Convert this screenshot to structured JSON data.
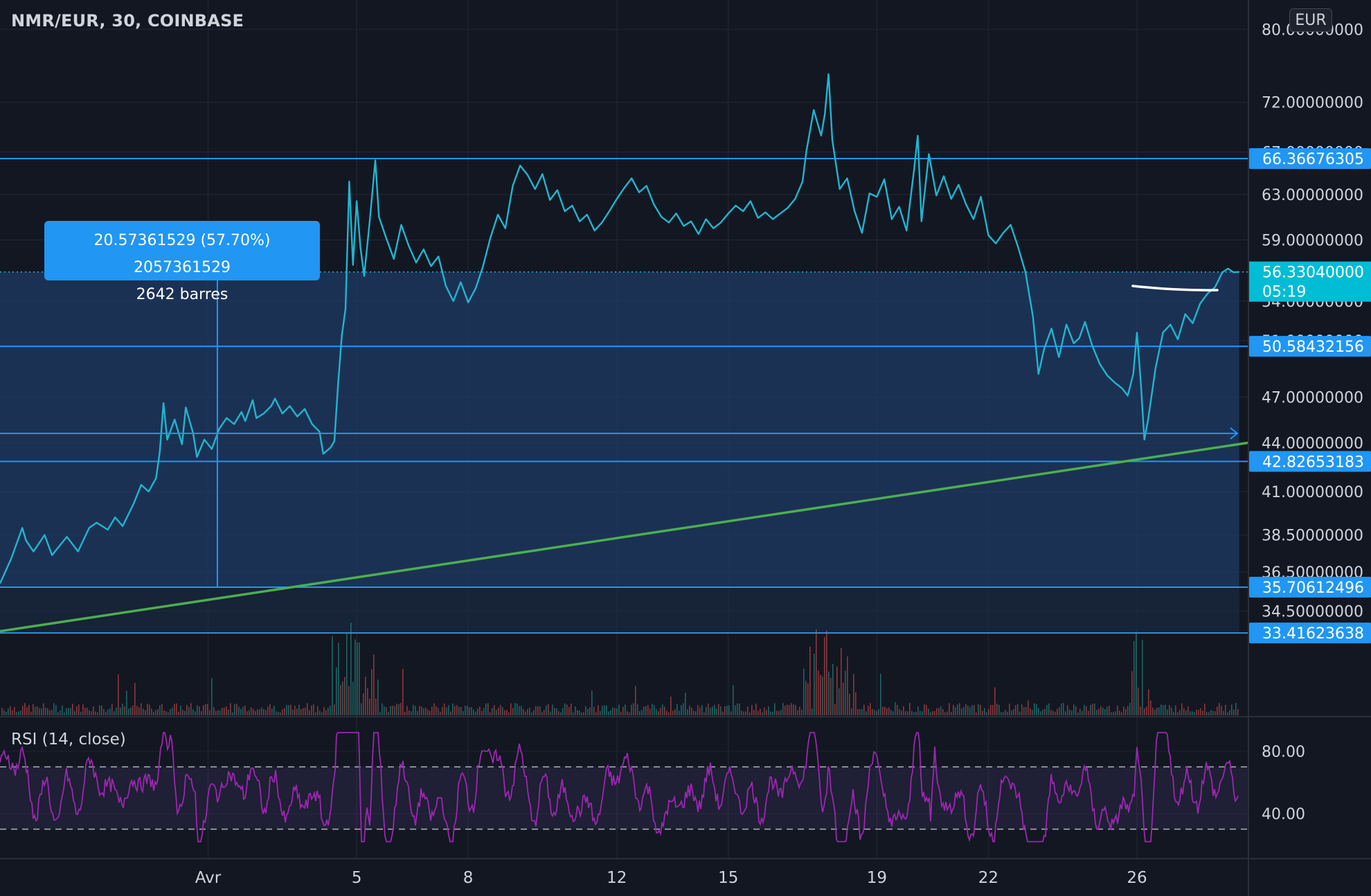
{
  "header": {
    "title": "NMR/EUR, 30, COINBASE",
    "currency": "EUR"
  },
  "measure": {
    "line1": "20.57361529 (57.70%) 2057361529",
    "line2": "2642 barres"
  },
  "rsi": {
    "title": "RSI (14, close)",
    "upper": 70,
    "lower": 30,
    "ticks": [
      "80.00",
      "40.00"
    ],
    "tick_values": [
      80,
      40
    ],
    "ylim": [
      12,
      100
    ]
  },
  "colors": {
    "background": "#131722",
    "price_line": "#22b5cf",
    "trend_line": "#4caf50",
    "level_line": "#2196f3",
    "rsi_line": "#9c27b0",
    "label_bg": "#2196f3",
    "last_price_bg": "#00bcd4",
    "volume_up": "#26a69a",
    "volume_down": "#ef5350"
  },
  "chart_data": {
    "type": "line",
    "title": "NMR/EUR, 30, COINBASE",
    "xlabel": "",
    "ylabel": "",
    "x_ticks": [
      {
        "label": "Avr",
        "day": 1
      },
      {
        "label": "5",
        "day": 5
      },
      {
        "label": "8",
        "day": 8
      },
      {
        "label": "12",
        "day": 12
      },
      {
        "label": "15",
        "day": 15
      },
      {
        "label": "19",
        "day": 19
      },
      {
        "label": "22",
        "day": 22
      },
      {
        "label": "26",
        "day": 26
      }
    ],
    "xlim": [
      -4.6,
      29.0
    ],
    "y_ticks": [
      "80.00000000",
      "72.00000000",
      "67.00000000",
      "63.00000000",
      "59.00000000",
      "54.00000000",
      "51.00000000",
      "47.00000000",
      "44.00000000",
      "41.00000000",
      "38.50000000",
      "36.50000000",
      "34.50000000"
    ],
    "y_tick_values": [
      80,
      72,
      67,
      63,
      59,
      54,
      51,
      47,
      44,
      41,
      38.5,
      36.5,
      34.5
    ],
    "scale": "log",
    "ylim": [
      32.4,
      81.0
    ],
    "grid": true,
    "series": [
      {
        "points": [
          [
            -4.6,
            35.9
          ],
          [
            -4.3,
            37.2
          ],
          [
            -4.0,
            38.9
          ],
          [
            -3.9,
            38.2
          ],
          [
            -3.7,
            37.6
          ],
          [
            -3.4,
            38.5
          ],
          [
            -3.2,
            37.4
          ],
          [
            -3.0,
            37.9
          ],
          [
            -2.8,
            38.4
          ],
          [
            -2.5,
            37.6
          ],
          [
            -2.2,
            38.9
          ],
          [
            -2.0,
            39.2
          ],
          [
            -1.7,
            38.8
          ],
          [
            -1.5,
            39.5
          ],
          [
            -1.3,
            39.0
          ],
          [
            -1.0,
            40.3
          ],
          [
            -0.8,
            41.4
          ],
          [
            -0.6,
            41.0
          ],
          [
            -0.4,
            41.8
          ],
          [
            -0.3,
            43.4
          ],
          [
            -0.2,
            46.6
          ],
          [
            -0.1,
            44.2
          ],
          [
            0.1,
            45.5
          ],
          [
            0.3,
            43.9
          ],
          [
            0.4,
            46.3
          ],
          [
            0.6,
            44.6
          ],
          [
            0.7,
            43.1
          ],
          [
            0.9,
            44.2
          ],
          [
            1.1,
            43.6
          ],
          [
            1.3,
            44.9
          ],
          [
            1.5,
            45.6
          ],
          [
            1.7,
            45.2
          ],
          [
            1.9,
            46.0
          ],
          [
            2.0,
            45.4
          ],
          [
            2.2,
            46.8
          ],
          [
            2.3,
            45.6
          ],
          [
            2.5,
            45.9
          ],
          [
            2.7,
            46.4
          ],
          [
            2.8,
            46.9
          ],
          [
            3.0,
            45.9
          ],
          [
            3.2,
            46.4
          ],
          [
            3.4,
            45.7
          ],
          [
            3.6,
            46.2
          ],
          [
            3.8,
            45.2
          ],
          [
            4.0,
            44.7
          ],
          [
            4.1,
            43.3
          ],
          [
            4.3,
            43.7
          ],
          [
            4.4,
            44.1
          ],
          [
            4.5,
            47.9
          ],
          [
            4.6,
            51.4
          ],
          [
            4.7,
            53.4
          ],
          [
            4.8,
            64.2
          ],
          [
            4.9,
            56.9
          ],
          [
            5.0,
            62.4
          ],
          [
            5.1,
            58.4
          ],
          [
            5.2,
            56.0
          ],
          [
            5.35,
            60.6
          ],
          [
            5.5,
            66.2
          ],
          [
            5.6,
            61.0
          ],
          [
            5.8,
            59.1
          ],
          [
            6.0,
            57.4
          ],
          [
            6.2,
            60.3
          ],
          [
            6.4,
            58.5
          ],
          [
            6.6,
            57.1
          ],
          [
            6.8,
            58.2
          ],
          [
            7.0,
            56.8
          ],
          [
            7.2,
            57.6
          ],
          [
            7.4,
            55.2
          ],
          [
            7.6,
            54.0
          ],
          [
            7.8,
            55.5
          ],
          [
            8.0,
            53.9
          ],
          [
            8.2,
            55.0
          ],
          [
            8.4,
            56.8
          ],
          [
            8.6,
            59.2
          ],
          [
            8.8,
            61.2
          ],
          [
            9.0,
            60.0
          ],
          [
            9.2,
            63.8
          ],
          [
            9.4,
            65.7
          ],
          [
            9.6,
            64.8
          ],
          [
            9.8,
            63.5
          ],
          [
            10.0,
            64.9
          ],
          [
            10.2,
            62.5
          ],
          [
            10.4,
            63.4
          ],
          [
            10.6,
            61.5
          ],
          [
            10.8,
            62.0
          ],
          [
            11.0,
            60.6
          ],
          [
            11.2,
            61.2
          ],
          [
            11.4,
            59.8
          ],
          [
            11.6,
            60.5
          ],
          [
            11.8,
            61.5
          ],
          [
            12.0,
            62.6
          ],
          [
            12.2,
            63.6
          ],
          [
            12.4,
            64.5
          ],
          [
            12.6,
            63.2
          ],
          [
            12.8,
            63.8
          ],
          [
            13.0,
            62.1
          ],
          [
            13.2,
            61.0
          ],
          [
            13.4,
            60.5
          ],
          [
            13.6,
            61.3
          ],
          [
            13.8,
            60.2
          ],
          [
            14.0,
            60.6
          ],
          [
            14.2,
            59.5
          ],
          [
            14.4,
            60.8
          ],
          [
            14.6,
            60.0
          ],
          [
            14.8,
            60.5
          ],
          [
            15.0,
            61.3
          ],
          [
            15.2,
            62.0
          ],
          [
            15.4,
            61.5
          ],
          [
            15.6,
            62.4
          ],
          [
            15.8,
            60.9
          ],
          [
            16.0,
            61.4
          ],
          [
            16.2,
            60.8
          ],
          [
            16.4,
            61.3
          ],
          [
            16.6,
            61.8
          ],
          [
            16.8,
            62.6
          ],
          [
            17.0,
            64.2
          ],
          [
            17.1,
            67.0
          ],
          [
            17.3,
            71.2
          ],
          [
            17.5,
            68.6
          ],
          [
            17.6,
            70.8
          ],
          [
            17.7,
            75.0
          ],
          [
            17.8,
            68.2
          ],
          [
            18.0,
            63.5
          ],
          [
            18.2,
            64.5
          ],
          [
            18.4,
            61.5
          ],
          [
            18.6,
            59.6
          ],
          [
            18.8,
            63.1
          ],
          [
            19.0,
            62.8
          ],
          [
            19.2,
            64.4
          ],
          [
            19.4,
            60.8
          ],
          [
            19.6,
            61.9
          ],
          [
            19.8,
            59.8
          ],
          [
            20.0,
            65.3
          ],
          [
            20.1,
            68.6
          ],
          [
            20.2,
            60.6
          ],
          [
            20.4,
            66.8
          ],
          [
            20.6,
            62.9
          ],
          [
            20.8,
            64.7
          ],
          [
            21.0,
            62.6
          ],
          [
            21.2,
            63.9
          ],
          [
            21.4,
            62.1
          ],
          [
            21.6,
            60.8
          ],
          [
            21.8,
            62.8
          ],
          [
            22.0,
            59.4
          ],
          [
            22.2,
            58.7
          ],
          [
            22.4,
            59.6
          ],
          [
            22.6,
            60.3
          ],
          [
            22.8,
            58.4
          ],
          [
            23.0,
            56.3
          ],
          [
            23.2,
            52.8
          ],
          [
            23.35,
            48.6
          ],
          [
            23.5,
            50.4
          ],
          [
            23.7,
            51.9
          ],
          [
            23.9,
            49.8
          ],
          [
            24.1,
            52.2
          ],
          [
            24.3,
            50.8
          ],
          [
            24.45,
            51.2
          ],
          [
            24.6,
            52.4
          ],
          [
            24.8,
            50.6
          ],
          [
            25.0,
            49.3
          ],
          [
            25.2,
            48.5
          ],
          [
            25.4,
            48.0
          ],
          [
            25.6,
            47.6
          ],
          [
            25.75,
            47.1
          ],
          [
            25.9,
            48.6
          ],
          [
            26.0,
            51.6
          ],
          [
            26.1,
            48.1
          ],
          [
            26.2,
            44.2
          ],
          [
            26.3,
            45.5
          ],
          [
            26.5,
            49.0
          ],
          [
            26.7,
            51.6
          ],
          [
            26.9,
            52.2
          ],
          [
            27.1,
            51.1
          ],
          [
            27.3,
            53.0
          ],
          [
            27.5,
            52.3
          ],
          [
            27.7,
            53.8
          ],
          [
            27.9,
            54.6
          ],
          [
            28.1,
            55.1
          ],
          [
            28.3,
            56.3
          ],
          [
            28.45,
            56.6
          ],
          [
            28.6,
            56.3
          ],
          [
            28.75,
            56.33
          ]
        ]
      }
    ],
    "horizontal_levels": [
      {
        "value": 66.36676305,
        "label": "66.36676305"
      },
      {
        "value": 50.58432156,
        "label": "50.58432156"
      },
      {
        "value": 42.82653183,
        "label": "42.82653183"
      },
      {
        "value": 35.70612496,
        "label": "35.70612496"
      },
      {
        "value": 33.41623638,
        "label": "33.41623638"
      }
    ],
    "last_price": {
      "value": 56.3304,
      "label": "56.33040000",
      "countdown": "05:19"
    },
    "trend_line": {
      "start": [
        -4.6,
        33.5
      ],
      "end": [
        29.0,
        44.0
      ]
    },
    "range_arrow": {
      "x": 1.25,
      "from": 35.70612496,
      "to": 56.3304
    },
    "horizontal_arrow": {
      "value": 44.6,
      "from_day": -4.6,
      "to_day": 28.7
    }
  }
}
